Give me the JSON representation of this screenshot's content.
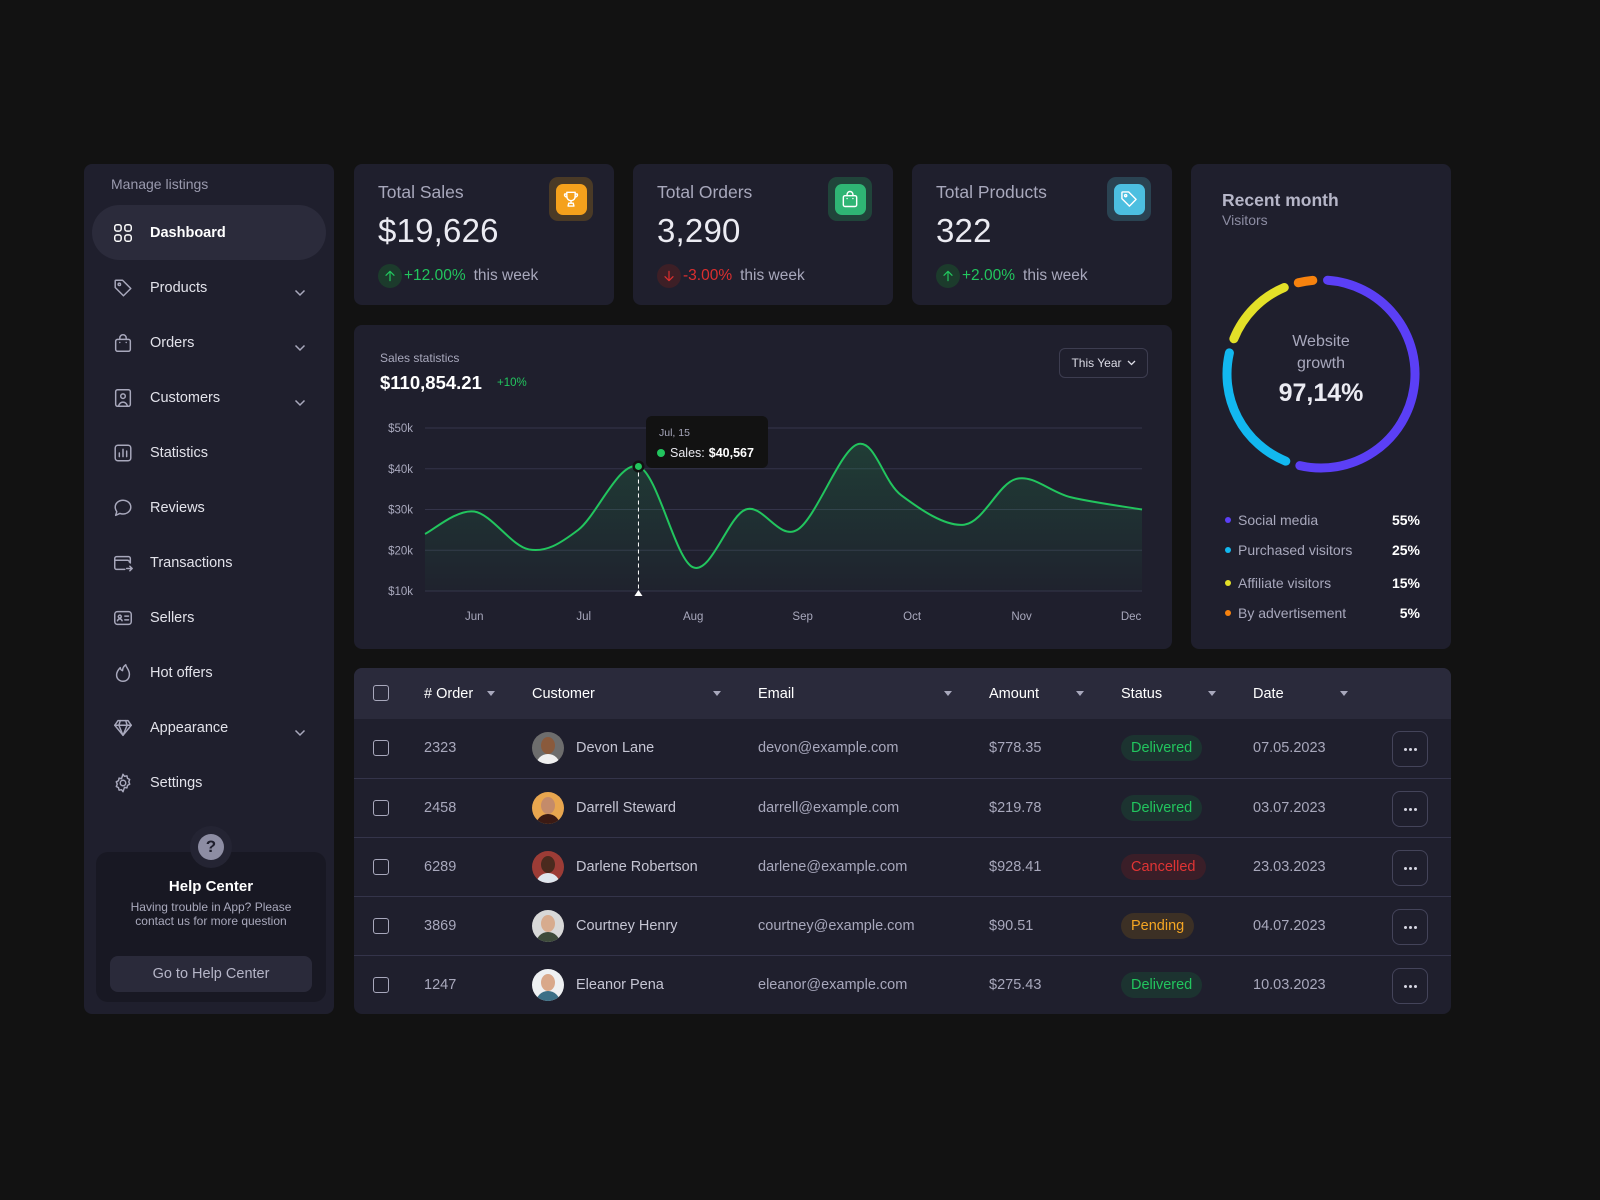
{
  "sidebar": {
    "heading": "Manage listings",
    "items": [
      {
        "label": "Dashboard",
        "icon": "grid-icon",
        "active": true,
        "has_chevron": false
      },
      {
        "label": "Products",
        "icon": "tag-icon",
        "active": false,
        "has_chevron": true
      },
      {
        "label": "Orders",
        "icon": "shopping-bag-icon",
        "active": false,
        "has_chevron": true
      },
      {
        "label": "Customers",
        "icon": "user-portrait-icon",
        "active": false,
        "has_chevron": true
      },
      {
        "label": "Statistics",
        "icon": "bar-chart-icon",
        "active": false,
        "has_chevron": false
      },
      {
        "label": "Reviews",
        "icon": "chat-bubble-icon",
        "active": false,
        "has_chevron": false
      },
      {
        "label": "Transactions",
        "icon": "wallet-icon",
        "active": false,
        "has_chevron": false
      },
      {
        "label": "Sellers",
        "icon": "id-card-icon",
        "active": false,
        "has_chevron": false
      },
      {
        "label": "Hot offers",
        "icon": "flame-icon",
        "active": false,
        "has_chevron": false
      },
      {
        "label": "Appearance",
        "icon": "diamond-icon",
        "active": false,
        "has_chevron": true
      },
      {
        "label": "Settings",
        "icon": "gear-icon",
        "active": false,
        "has_chevron": false
      }
    ],
    "help": {
      "icon": "question-icon",
      "title": "Help Center",
      "text": "Having trouble in App? Please contact us for more question",
      "button": "Go to Help Center"
    }
  },
  "kpis": [
    {
      "title": "Total Sales",
      "value": "$19,626",
      "change": "+12.00%",
      "direction": "up",
      "period": "this week",
      "icon": "trophy-icon",
      "color": "#f5a11c",
      "badge_bg": "#4a3a26"
    },
    {
      "title": "Total Orders",
      "value": "3,290",
      "change": "-3.00%",
      "direction": "down",
      "period": "this week",
      "icon": "shopping-bag-icon",
      "color": "#2fb574",
      "badge_bg": "#20443a"
    },
    {
      "title": "Total Products",
      "value": "322",
      "change": "+2.00%",
      "direction": "up",
      "period": "this week",
      "icon": "tag-icon",
      "color": "#4cbfe0",
      "badge_bg": "#2a4352"
    }
  ],
  "colors": {
    "up": "#22c55e",
    "up_bg": "#1c3b2c",
    "down": "#dc2f2f",
    "down_bg": "#3d1f26",
    "line": "#22c55e"
  },
  "sales": {
    "title": "Sales statistics",
    "total": "$110,854.21",
    "change": "+10%",
    "period_select": "This Year",
    "tooltip": {
      "date": "Jul, 15",
      "label": "Sales:",
      "value": "$40,567"
    }
  },
  "chart_data": {
    "type": "area",
    "title": "Sales statistics",
    "xlabel": "",
    "ylabel": "",
    "x_ticks": [
      "Jun",
      "Jul",
      "Aug",
      "Sep",
      "Oct",
      "Nov",
      "Dec"
    ],
    "y_ticks": [
      "$10k",
      "$20k",
      "$30k",
      "$40k",
      "$50k"
    ],
    "ylim": [
      10000,
      50000
    ],
    "xlim": [
      5.55,
      12.1
    ],
    "grid": true,
    "series": [
      {
        "name": "Sales",
        "x": [
          5.55,
          6.0,
          6.5,
          6.95,
          7.5,
          8.0,
          8.48,
          8.95,
          9.5,
          9.9,
          10.48,
          10.95,
          11.45,
          12.1
        ],
        "values": [
          24000,
          29500,
          20200,
          25000,
          40567,
          15800,
          30000,
          25000,
          46000,
          33500,
          26300,
          37500,
          33000,
          30000
        ]
      }
    ],
    "highlight": {
      "x": 7.5,
      "label": "Jul, 15",
      "value": 40567
    }
  },
  "visitors": {
    "title": "Recent month",
    "subtitle": "Visitors",
    "center_label": "Website growth",
    "center_value": "97,14%",
    "segments": [
      {
        "name": "Social media",
        "value": "55%",
        "share": 55,
        "color": "#5b3ff6"
      },
      {
        "name": "Purchased visitors",
        "value": "25%",
        "share": 25,
        "color": "#12b8f0"
      },
      {
        "name": "Affiliate visitors",
        "value": "15%",
        "share": 15,
        "color": "#e3e028"
      },
      {
        "name": "By advertisement",
        "value": "5%",
        "share": 5,
        "color": "#f7820e"
      }
    ]
  },
  "orders": {
    "columns": [
      "# Order",
      "Customer",
      "Email",
      "Amount",
      "Status",
      "Date"
    ],
    "rows": [
      {
        "order": "2323",
        "customer": "Devon Lane",
        "email": "devon@example.com",
        "amount": "$778.35",
        "status": "Delivered",
        "date": "07.05.2023",
        "avatar_bg": "#6d6d6d",
        "skin": "#8a5a3c",
        "shirt": "#f0f0f0"
      },
      {
        "order": "2458",
        "customer": "Darrell Steward",
        "email": "darrell@example.com",
        "amount": "$219.78",
        "status": "Delivered",
        "date": "03.07.2023",
        "avatar_bg": "#e8a64f",
        "skin": "#c48b6a",
        "shirt": "#3a1a14"
      },
      {
        "order": "6289",
        "customer": "Darlene Robertson",
        "email": "darlene@example.com",
        "amount": "$928.41",
        "status": "Cancelled",
        "date": "23.03.2023",
        "avatar_bg": "#9c3c36",
        "skin": "#4a2a1e",
        "shirt": "#dfe6ee"
      },
      {
        "order": "3869",
        "customer": "Courtney Henry",
        "email": "courtney@example.com",
        "amount": "$90.51",
        "status": "Pending",
        "date": "04.07.2023",
        "avatar_bg": "#d8d8d8",
        "skin": "#d7ab8e",
        "shirt": "#3d4a3a"
      },
      {
        "order": "1247",
        "customer": "Eleanor Pena",
        "email": "eleanor@example.com",
        "amount": "$275.43",
        "status": "Delivered",
        "date": "10.03.2023",
        "avatar_bg": "#eef0f2",
        "skin": "#d9a88a",
        "shirt": "#3b6f86"
      }
    ],
    "status_styles": {
      "Delivered": {
        "color": "#22c55e",
        "bg": "#1c3330"
      },
      "Cancelled": {
        "color": "#e03434",
        "bg": "#3a1e28"
      },
      "Pending": {
        "color": "#f5a623",
        "bg": "#3c3025"
      }
    }
  }
}
